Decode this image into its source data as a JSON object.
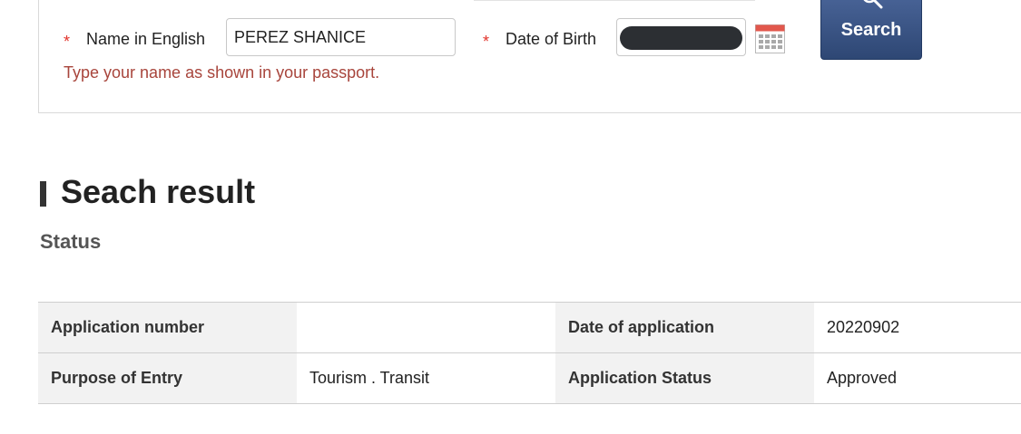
{
  "form": {
    "name_label": "Name in English",
    "name_value": "PEREZ SHANICE",
    "dob_label": "Date of Birth",
    "required_marker": "*",
    "hint": "Type your name as shown in your passport.",
    "search_label": "Search"
  },
  "result": {
    "title": "Seach result",
    "subtitle": "Status",
    "rows": [
      {
        "label1": "Application number",
        "value1": "",
        "label2": "Date of application",
        "value2": "20220902"
      },
      {
        "label1": "Purpose of Entry",
        "value1": "Tourism . Transit",
        "label2": "Application Status",
        "value2": "Approved"
      }
    ]
  },
  "colors": {
    "required": "#e2342c",
    "hint": "#a8453c",
    "button": "#2e4774",
    "header_cell": "#f2f2f2"
  },
  "icons": [
    "calendar-icon",
    "magnifier-icon"
  ]
}
